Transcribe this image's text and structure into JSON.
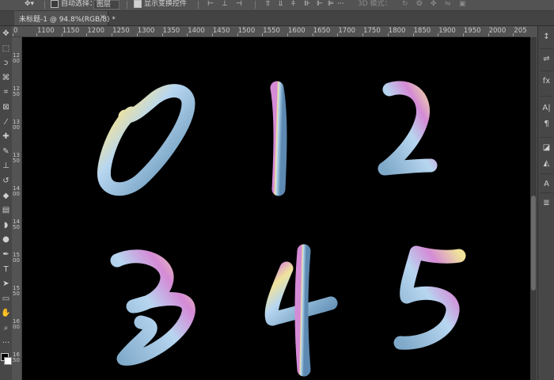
{
  "options_bar": {
    "auto_select_label": "自动选择：",
    "layer_select_value": "图层",
    "show_transform_label": "显示变换控件",
    "three_d_label": "3D 模式："
  },
  "document": {
    "tab_title": "未标题-1 @ 94.8%(RGB/8) *",
    "close_glyph": "×"
  },
  "ruler": {
    "h_labels": [
      "0",
      "1100",
      "1150",
      "1200",
      "1250",
      "1300",
      "1350",
      "1400",
      "1450",
      "1500",
      "1550",
      "1600",
      "1650",
      "1700",
      "1750",
      "1800",
      "1850",
      "1900",
      "1950",
      "2000",
      "205"
    ],
    "v_labels": [
      "1200",
      "1250",
      "1300",
      "1350",
      "1400",
      "1450",
      "1500",
      "1550",
      "1600",
      "1650"
    ]
  },
  "canvas": {
    "digits": [
      "0",
      "1",
      "2",
      "3",
      "4",
      "5"
    ],
    "background_color": "#000000",
    "stroke_colors": [
      "#7fa9c9",
      "#b7d6f0",
      "#f0e39b",
      "#d58ad6"
    ]
  },
  "tools": [
    {
      "name": "move-tool-icon",
      "glyph": "✥"
    },
    {
      "name": "marquee-tool-icon",
      "glyph": "⬚"
    },
    {
      "name": "lasso-tool-icon",
      "glyph": "ↄ"
    },
    {
      "name": "quick-select-tool-icon",
      "glyph": "⌘"
    },
    {
      "name": "crop-tool-icon",
      "glyph": "⌗"
    },
    {
      "name": "frame-tool-icon",
      "glyph": "⊠"
    },
    {
      "name": "eyedropper-tool-icon",
      "glyph": "⁄"
    },
    {
      "name": "healing-brush-tool-icon",
      "glyph": "✚"
    },
    {
      "name": "brush-tool-icon",
      "glyph": "✎"
    },
    {
      "name": "clone-stamp-tool-icon",
      "glyph": "⊥"
    },
    {
      "name": "history-brush-tool-icon",
      "glyph": "↺"
    },
    {
      "name": "eraser-tool-icon",
      "glyph": "◆"
    },
    {
      "name": "gradient-tool-icon",
      "glyph": "▤"
    },
    {
      "name": "blur-tool-icon",
      "glyph": "◗"
    },
    {
      "name": "dodge-tool-icon",
      "glyph": "●"
    },
    {
      "name": "pen-tool-icon",
      "glyph": "✒"
    },
    {
      "name": "type-tool-icon",
      "glyph": "T"
    },
    {
      "name": "path-select-tool-icon",
      "glyph": "➤"
    },
    {
      "name": "shape-tool-icon",
      "glyph": "▭"
    },
    {
      "name": "hand-tool-icon",
      "glyph": "✋"
    },
    {
      "name": "zoom-tool-icon",
      "glyph": "⌕"
    },
    {
      "name": "more-tools-icon",
      "glyph": "···"
    }
  ],
  "right_panel": [
    {
      "name": "arrange-icon",
      "glyph": "↕"
    },
    {
      "name": "adjust-icon",
      "glyph": "⇌"
    },
    {
      "name": "fx-icon",
      "glyph": "fx"
    },
    {
      "name": "character-icon",
      "glyph": "A|"
    },
    {
      "name": "paragraph-icon",
      "glyph": "¶"
    },
    {
      "name": "layer-comps-icon",
      "glyph": "◪"
    },
    {
      "name": "shape-icon",
      "glyph": "◭"
    },
    {
      "name": "glyphs-icon",
      "glyph": "A"
    },
    {
      "name": "properties-icon",
      "glyph": "≣"
    }
  ]
}
